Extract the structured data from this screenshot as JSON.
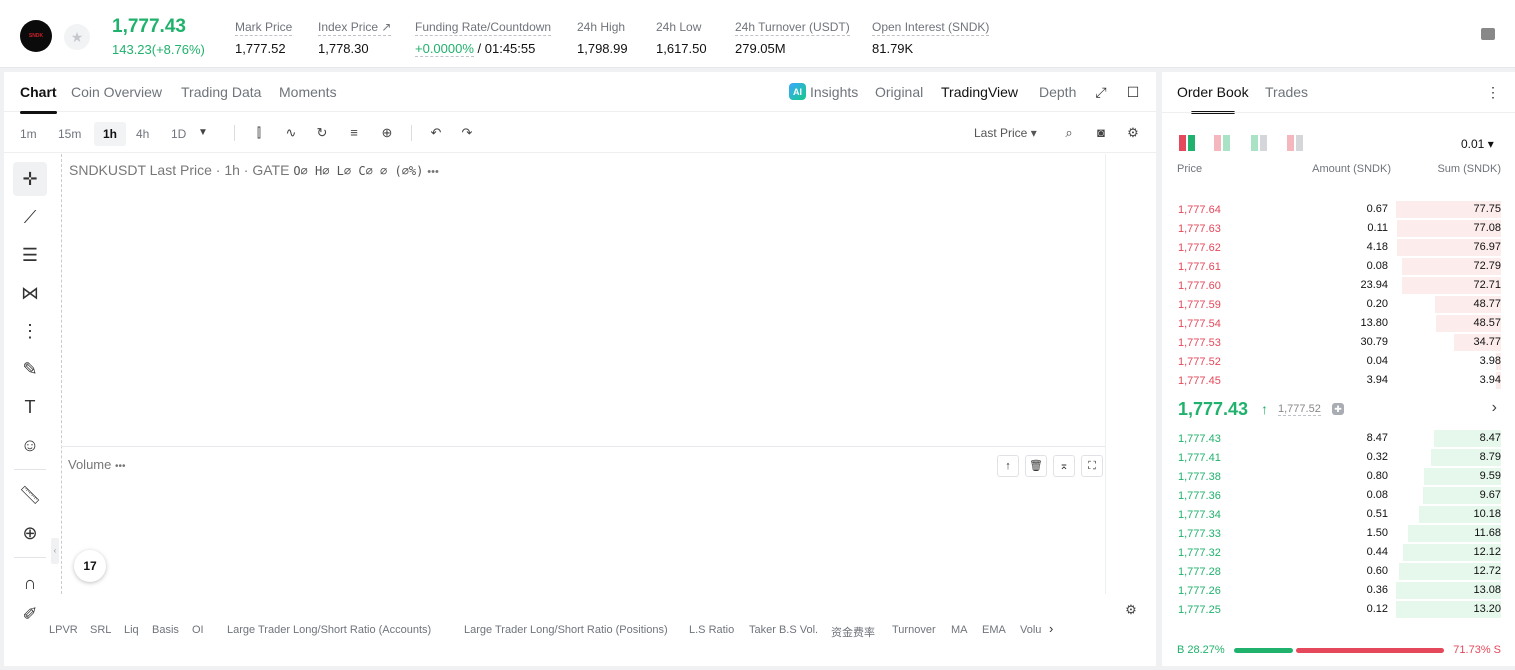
{
  "ticker": {
    "logo_text": "SNDK",
    "last_price": "1,777.43",
    "change": "143.23(+8.76%)",
    "stats": [
      {
        "label": "Mark Price",
        "value": "1,777.52"
      },
      {
        "label": "Index Price ↗",
        "value": "1,778.30"
      },
      {
        "label": "Funding Rate/Countdown",
        "value_green": "+0.0000%",
        "value": " / 01:45:55"
      },
      {
        "label": "24h High",
        "value": "1,798.99"
      },
      {
        "label": "24h Low",
        "value": "1,617.50"
      },
      {
        "label": "24h Turnover (USDT)",
        "value": "279.05M"
      },
      {
        "label": "Open Interest (SNDK)",
        "value": "81.79K"
      }
    ]
  },
  "chart_tabs": [
    "Chart",
    "Coin Overview",
    "Trading Data",
    "Moments"
  ],
  "view_options": {
    "ai_badge": "AI",
    "insights": "Insights",
    "original": "Original",
    "tradingview": "TradingView",
    "depth": "Depth"
  },
  "timeframes": [
    "1m",
    "15m",
    "1h",
    "4h",
    "1D"
  ],
  "price_type_select": "Last Price ▾",
  "legend": {
    "symbol": "SNDKUSDT Last Price · 1h · GATE",
    "ohlc": "O∅ H∅ L∅ C∅ ∅ (∅%)",
    "more": "•••"
  },
  "volume": {
    "label": "Volume",
    "more": "•••"
  },
  "tv_logo": "17",
  "indicators": [
    "LPVR",
    "SRL",
    "Liq",
    "Basis",
    "OI",
    "Large Trader Long/Short Ratio (Accounts)",
    "Large Trader Long/Short Ratio (Positions)",
    "L.S Ratio",
    "Taker B.S Vol.",
    "资金费率",
    "Turnover",
    "MA",
    "EMA",
    "Volu"
  ],
  "order_book": {
    "tabs": [
      "Order Book",
      "Trades"
    ],
    "precision": "0.01 ▾",
    "columns": {
      "price": "Price",
      "amount": "Amount (SNDK)",
      "sum": "Sum (SNDK)"
    },
    "asks": [
      {
        "price": "1,777.64",
        "amount": "0.67",
        "sum": "77.75",
        "depth": 1.0
      },
      {
        "price": "1,777.63",
        "amount": "0.11",
        "sum": "77.08",
        "depth": 0.99
      },
      {
        "price": "1,777.62",
        "amount": "4.18",
        "sum": "76.97",
        "depth": 0.99
      },
      {
        "price": "1,777.61",
        "amount": "0.08",
        "sum": "72.79",
        "depth": 0.94
      },
      {
        "price": "1,777.60",
        "amount": "23.94",
        "sum": "72.71",
        "depth": 0.94
      },
      {
        "price": "1,777.59",
        "amount": "0.20",
        "sum": "48.77",
        "depth": 0.63
      },
      {
        "price": "1,777.54",
        "amount": "13.80",
        "sum": "48.57",
        "depth": 0.62
      },
      {
        "price": "1,777.53",
        "amount": "30.79",
        "sum": "34.77",
        "depth": 0.45
      },
      {
        "price": "1,777.52",
        "amount": "0.04",
        "sum": "3.98",
        "depth": 0.05
      },
      {
        "price": "1,777.45",
        "amount": "3.94",
        "sum": "3.94",
        "depth": 0.05
      }
    ],
    "mid_price": "1,777.43",
    "mid_arrow": "↑",
    "mark_price": "1,777.52",
    "bids": [
      {
        "price": "1,777.43",
        "amount": "8.47",
        "sum": "8.47",
        "depth": 0.64
      },
      {
        "price": "1,777.41",
        "amount": "0.32",
        "sum": "8.79",
        "depth": 0.67
      },
      {
        "price": "1,777.38",
        "amount": "0.80",
        "sum": "9.59",
        "depth": 0.73
      },
      {
        "price": "1,777.36",
        "amount": "0.08",
        "sum": "9.67",
        "depth": 0.74
      },
      {
        "price": "1,777.34",
        "amount": "0.51",
        "sum": "10.18",
        "depth": 0.78
      },
      {
        "price": "1,777.33",
        "amount": "1.50",
        "sum": "11.68",
        "depth": 0.89
      },
      {
        "price": "1,777.32",
        "amount": "0.44",
        "sum": "12.12",
        "depth": 0.93
      },
      {
        "price": "1,777.28",
        "amount": "0.60",
        "sum": "12.72",
        "depth": 0.97
      },
      {
        "price": "1,777.26",
        "amount": "0.36",
        "sum": "13.08",
        "depth": 1.0
      },
      {
        "price": "1,777.25",
        "amount": "0.12",
        "sum": "13.20",
        "depth": 1.0
      }
    ],
    "buy_ratio": "B 28.27%",
    "sell_ratio": "71.73% S",
    "buy_fraction": 0.2827
  },
  "colors": {
    "green": "#20b26c",
    "red": "#e5485a"
  }
}
